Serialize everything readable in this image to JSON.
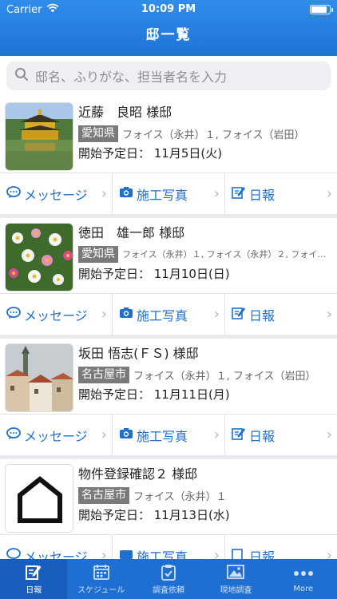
{
  "status": {
    "carrier": "Carrier",
    "time": "10:09 PM"
  },
  "nav": {
    "title": "邸一覧"
  },
  "search": {
    "placeholder": "邸名、ふりがな、担当者名を入力"
  },
  "cards": [
    {
      "name": "近藤　良昭 様邸",
      "pref": "愛知県",
      "staff": "フォイス（永井）１, フォイス（岩田）",
      "date": "開始予定日：  11月5日(火)",
      "thumb": "golden-pavilion"
    },
    {
      "name": "徳田　雄一郎 様邸",
      "pref": "愛知県",
      "staff": "フォイス（永井）１, フォイス（永井）２, フォイ…",
      "date": "開始予定日：  11月10日(日)",
      "thumb": "flowers"
    },
    {
      "name": "坂田 悟志(ＦＳ) 様邸",
      "pref": "名古屋市",
      "staff": "フォイス（永井）１, フォイス（岩田）",
      "date": "開始予定日：  11月11日(月)",
      "thumb": "town"
    },
    {
      "name": "物件登録確認２ 様邸",
      "pref": "名古屋市",
      "staff": "フォイス（永井）１",
      "date": "開始予定日：  11月13日(水)",
      "thumb": "house-icon"
    }
  ],
  "actions": {
    "message": "メッセージ",
    "photo": "施工写真",
    "report": "日報"
  },
  "tabs": [
    {
      "label": "日報",
      "icon": "report-icon"
    },
    {
      "label": "スケジュール",
      "icon": "calendar-icon"
    },
    {
      "label": "調査依頼",
      "icon": "clipboard-icon"
    },
    {
      "label": "現地調査",
      "icon": "photo-icon"
    },
    {
      "label": "More",
      "icon": "more-icon"
    }
  ],
  "colors": {
    "accent": "#1f6fd2",
    "link": "#1f6fcf",
    "badge": "#7a7a7a"
  }
}
